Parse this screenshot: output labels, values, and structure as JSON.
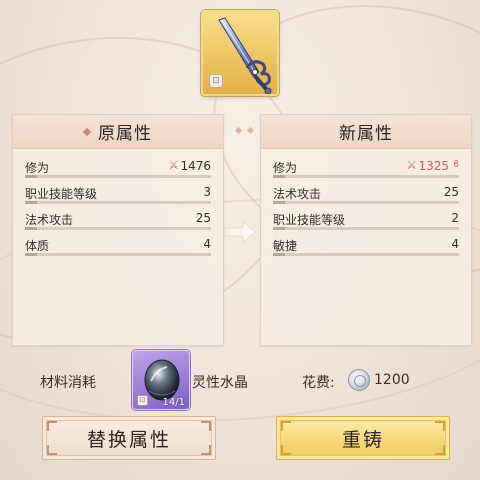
{
  "item": {
    "icon": "sword-icon",
    "lock_icon": "lock-icon"
  },
  "original_panel": {
    "title": "原属性",
    "attributes": [
      {
        "name": "修为",
        "value": "1476",
        "icon": "crossed-swords-icon"
      },
      {
        "name": "职业技能等级",
        "value": "3"
      },
      {
        "name": "法术攻击",
        "value": "25"
      },
      {
        "name": "体质",
        "value": "4"
      }
    ]
  },
  "new_panel": {
    "title": "新属性",
    "attributes": [
      {
        "name": "修为",
        "value": "1325",
        "icon": "crossed-swords-icon",
        "trend_icon": "decrease-icon",
        "color": "#e0554e"
      },
      {
        "name": "法术攻击",
        "value": "25"
      },
      {
        "name": "职业技能等级",
        "value": "2"
      },
      {
        "name": "敏捷",
        "value": "4"
      }
    ]
  },
  "material": {
    "label": "材料消耗",
    "name": "灵性水晶",
    "count": "14/1",
    "icon": "spirit-crystal-icon"
  },
  "cost": {
    "label": "花费:",
    "value": "1200",
    "icon": "silver-coin-icon"
  },
  "buttons": {
    "replace": "替换属性",
    "recast": "重铸"
  },
  "colors": {
    "accent_red": "#e0554e",
    "recast_button": "#f5d778",
    "item_frame": "#ecc35e",
    "material_frame": "#9a7ed8"
  }
}
